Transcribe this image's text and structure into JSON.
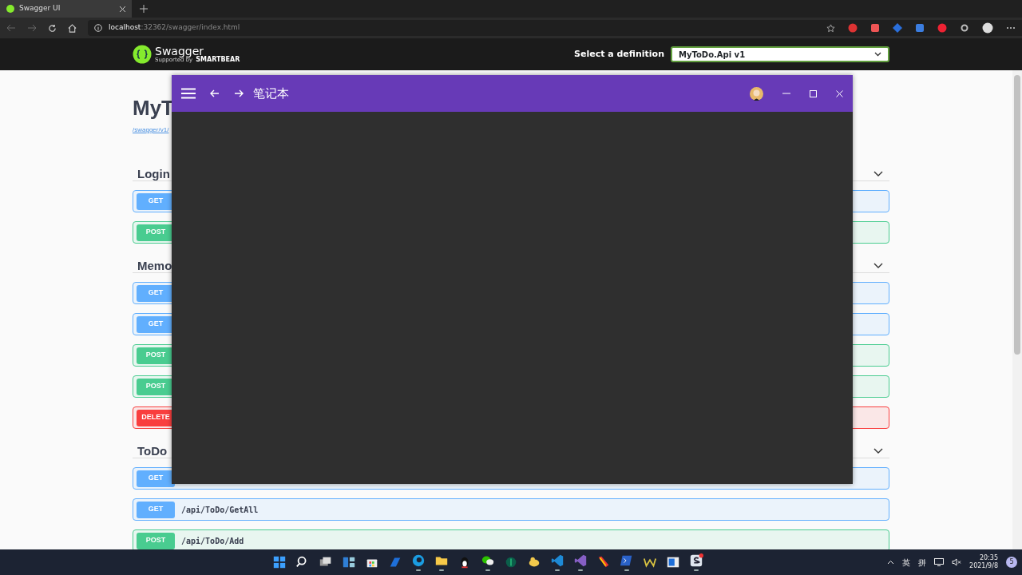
{
  "browser": {
    "tabs": [
      {
        "title": "Swagger UI",
        "selected": true
      }
    ],
    "address": {
      "host": "localhost",
      "rest": ":32362/swagger/index.html"
    }
  },
  "swagger_header": {
    "logo": "Swagger",
    "logo_sub_1": "Supported by",
    "logo_sub_2": "SMARTBEAR",
    "definition_label": "Select a definition",
    "definition_value": "MyToDo.Api v1"
  },
  "page": {
    "title": "MyT",
    "link": "/swagger/v1/"
  },
  "sections": [
    {
      "name": "Login",
      "expanded": true,
      "operations": [
        {
          "method": "GET"
        },
        {
          "method": "POST"
        }
      ]
    },
    {
      "name": "Memo",
      "expanded": true,
      "operations": [
        {
          "method": "GET"
        },
        {
          "method": "GET"
        },
        {
          "method": "POST"
        },
        {
          "method": "POST"
        },
        {
          "method": "DELETE"
        }
      ]
    },
    {
      "name": "ToDo",
      "expanded": true,
      "operations": [
        {
          "method": "GET"
        },
        {
          "method": "GET",
          "path": "/api/ToDo/GetAll"
        },
        {
          "method": "POST",
          "path": "/api/ToDo/Add"
        }
      ]
    }
  ],
  "app_window": {
    "title": "笔记本"
  },
  "taskbar": {
    "apps": [
      {
        "running": false
      },
      {
        "running": false
      },
      {
        "running": false
      },
      {
        "running": false
      },
      {
        "running": false
      },
      {
        "running": false
      },
      {
        "running": true
      },
      {
        "running": true
      },
      {
        "running": false
      },
      {
        "running": true
      },
      {
        "running": false
      },
      {
        "running": false
      },
      {
        "running": true
      },
      {
        "running": true
      },
      {
        "running": false
      },
      {
        "running": true
      },
      {
        "running": false
      },
      {
        "running": false
      },
      {
        "running": true
      }
    ],
    "tray": {
      "ime_1": "英",
      "ime_2": "拼",
      "time": "20:35",
      "date": "2021/9/8",
      "notifications": "5"
    }
  }
}
